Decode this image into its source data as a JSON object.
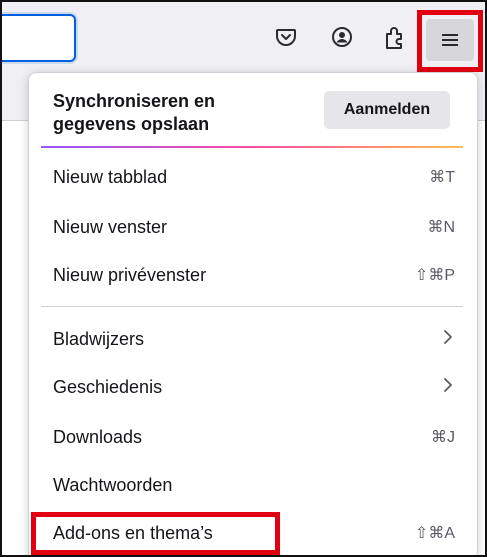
{
  "toolbar": {
    "icons": [
      "pocket-icon",
      "account-icon",
      "extensions-icon",
      "hamburger-menu-icon"
    ]
  },
  "menu": {
    "sync_title": "Synchroniseren en gegevens opslaan",
    "sync_title_line1": "Synchroniseren en",
    "sync_title_line2": "gegevens opslaan",
    "sign_in_label": "Aanmelden",
    "items": [
      {
        "label": "Nieuw tabblad",
        "shortcut": "⌘T"
      },
      {
        "label": "Nieuw venster",
        "shortcut": "⌘N"
      },
      {
        "label": "Nieuw privévenster",
        "shortcut": "⇧⌘P"
      },
      {
        "label": "Bladwijzers",
        "submenu": true
      },
      {
        "label": "Geschiedenis",
        "submenu": true
      },
      {
        "label": "Downloads",
        "shortcut": "⌘J"
      },
      {
        "label": "Wachtwoorden",
        "shortcut": ""
      },
      {
        "label": "Add-ons en thema’s",
        "shortcut": "⇧⌘A"
      }
    ]
  },
  "highlight_color": "#e1000f",
  "accent_color": "#0061e0"
}
